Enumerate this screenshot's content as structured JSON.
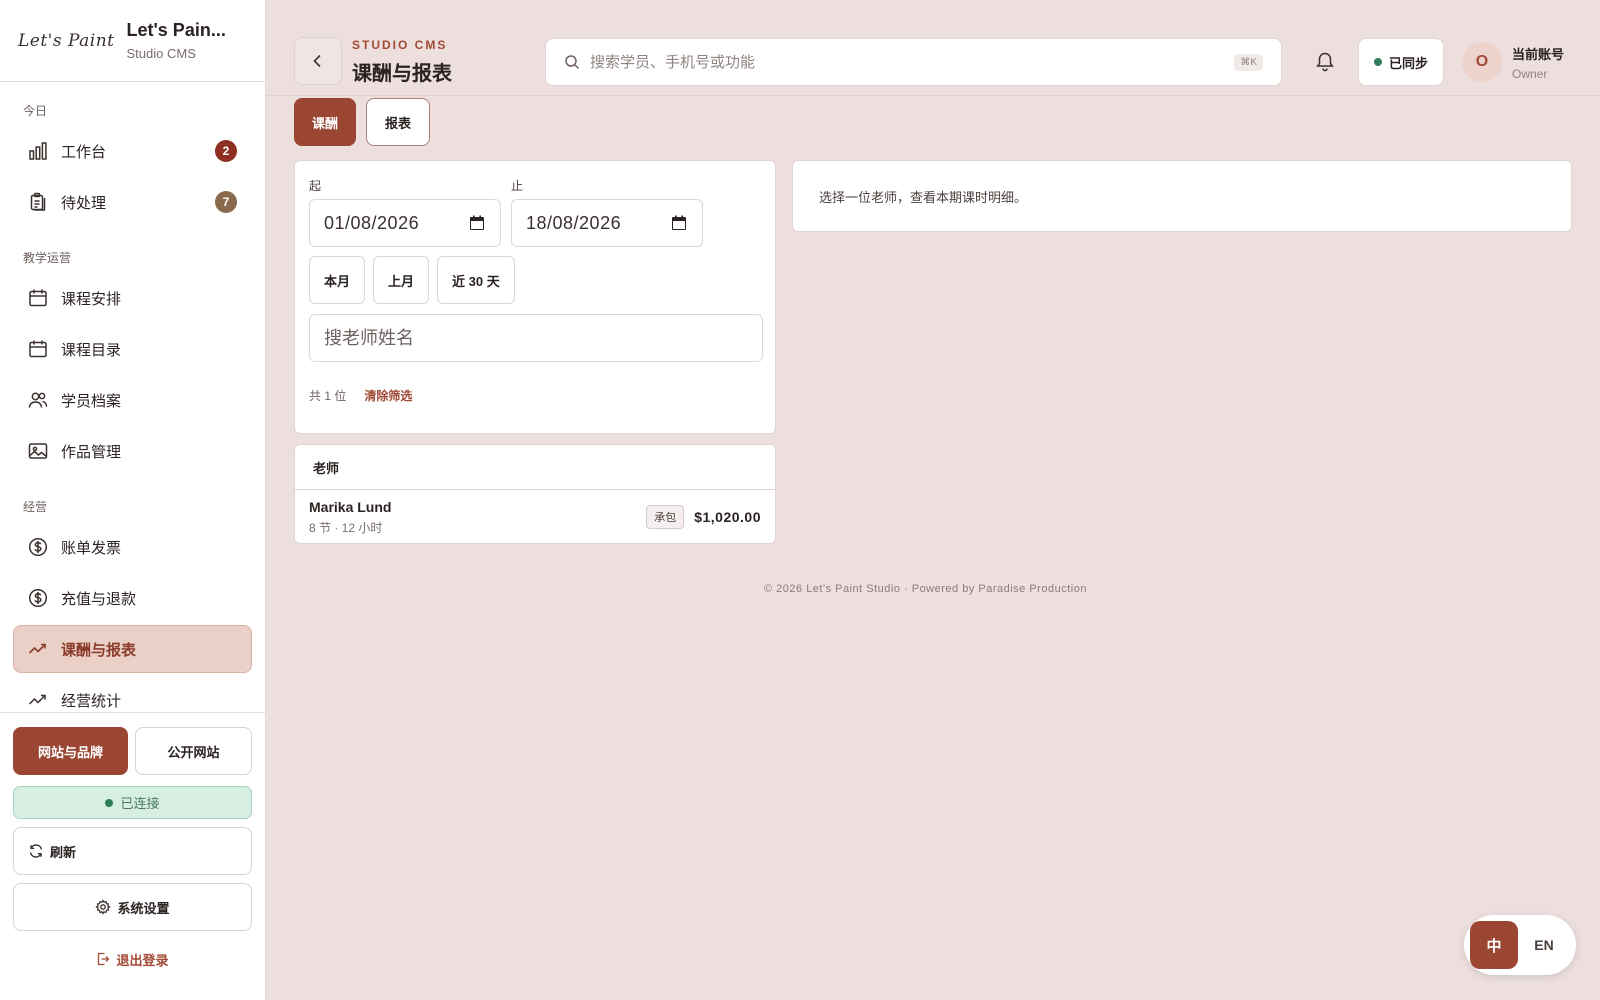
{
  "brand": {
    "logo_text": "Let's Paint",
    "name": "Let's Pain...",
    "subtitle": "Studio CMS"
  },
  "sidebar": {
    "sections": [
      {
        "label": "今日",
        "items": [
          {
            "label": "工作台",
            "icon": "bar-chart-icon",
            "badge": "2",
            "badge_color": "#8e2f22"
          },
          {
            "label": "待处理",
            "icon": "clipboard-icon",
            "badge": "7",
            "badge_color": "#8a6a4d"
          }
        ]
      },
      {
        "label": "教学运营",
        "items": [
          {
            "label": "课程安排",
            "icon": "calendar-icon"
          },
          {
            "label": "课程目录",
            "icon": "calendar-icon"
          },
          {
            "label": "学员档案",
            "icon": "users-icon"
          },
          {
            "label": "作品管理",
            "icon": "image-icon"
          }
        ]
      },
      {
        "label": "经营",
        "items": [
          {
            "label": "账单发票",
            "icon": "dollar-circle-icon"
          },
          {
            "label": "充值与退款",
            "icon": "dollar-circle-icon"
          },
          {
            "label": "课酬与报表",
            "icon": "trend-icon",
            "active": true
          },
          {
            "label": "经营统计",
            "icon": "trend-icon"
          }
        ]
      }
    ],
    "bottom": {
      "website_brand": "网站与品牌",
      "public_site": "公开网站",
      "connected": "已连接",
      "refresh": "刷新",
      "settings": "系统设置",
      "logout": "退出登录"
    }
  },
  "header": {
    "eyebrow": "STUDIO CMS",
    "title": "课酬与报表",
    "search_placeholder": "搜索学员、手机号或功能",
    "search_shortcut": "⌘K",
    "sync_status": "已同步",
    "avatar_initial": "O",
    "account_name": "当前账号",
    "account_role": "Owner"
  },
  "tabs": [
    {
      "label": "课酬",
      "active": true
    },
    {
      "label": "报表",
      "active": false
    }
  ],
  "filters": {
    "from_label": "起",
    "from_value": "01/08/2026",
    "to_label": "止",
    "to_value": "18/08/2026",
    "quick_ranges": [
      "本月",
      "上月",
      "近 30 天"
    ],
    "teacher_search_placeholder": "搜老师姓名",
    "count_text": "共 1 位",
    "clear_label": "清除筛选"
  },
  "teacher_list": {
    "header": "老师",
    "rows": [
      {
        "name": "Marika Lund",
        "meta": "8 节 · 12 小时",
        "tag": "承包",
        "amount": "$1,020.00"
      }
    ]
  },
  "detail": {
    "empty_text": "选择一位老师，查看本期课时明细。"
  },
  "footer": {
    "text": "© 2026 Let's Paint Studio · Powered by Paradise Production"
  },
  "language": {
    "zh": "中",
    "en": "EN"
  },
  "colors": {
    "accent": "#9a4633",
    "accent_text": "#a14b36",
    "background": "#ecdfdd",
    "success": "#2f7d58"
  }
}
